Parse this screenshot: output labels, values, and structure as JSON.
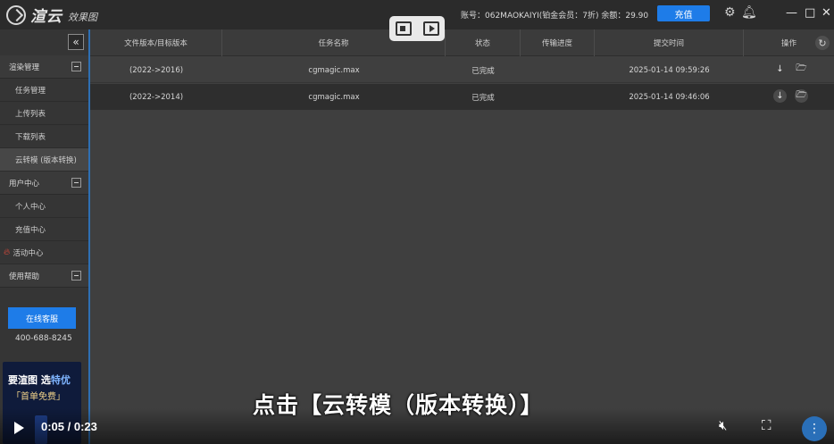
{
  "titlebar": {
    "logo_text": "渲云",
    "logo_sub": "效果图",
    "account_text": "账号：062MAOKAIYI(铂金会员：7折) 余额：29.90",
    "recharge_label": "充值"
  },
  "sidebar": {
    "groups": [
      {
        "label": "渲染管理",
        "items": [
          "任务管理",
          "上传列表",
          "下载列表",
          "云转模 (版本转换)"
        ]
      },
      {
        "label": "用户中心",
        "items": [
          "个人中心",
          "充值中心",
          "活动中心"
        ]
      },
      {
        "label": "使用帮助",
        "items": []
      }
    ],
    "service_label": "在线客服",
    "phone": "400-688-8245",
    "promo_line1_a": "要渲图 选",
    "promo_line1_b": "特优",
    "promo_line2": "「首单免费」"
  },
  "table": {
    "headers": [
      "文件版本/目标版本",
      "任务名称",
      "状态",
      "传输进度",
      "提交时间",
      "操作"
    ],
    "rows": [
      {
        "version": "(2022->2016)",
        "name": "cgmagic.max",
        "status": "已完成",
        "progress": "",
        "time": "2025-01-14 09:59:26"
      },
      {
        "version": "(2022->2014)",
        "name": "cgmagic.max",
        "status": "已完成",
        "progress": "",
        "time": "2025-01-14 09:46:06"
      }
    ]
  },
  "video": {
    "subtitle": "点击【云转模（版本转换）】",
    "time": "0:05 / 0:23"
  },
  "colors": {
    "accent": "#1e7ce8",
    "background": "#3f3f3f",
    "sidebar": "#353535"
  }
}
